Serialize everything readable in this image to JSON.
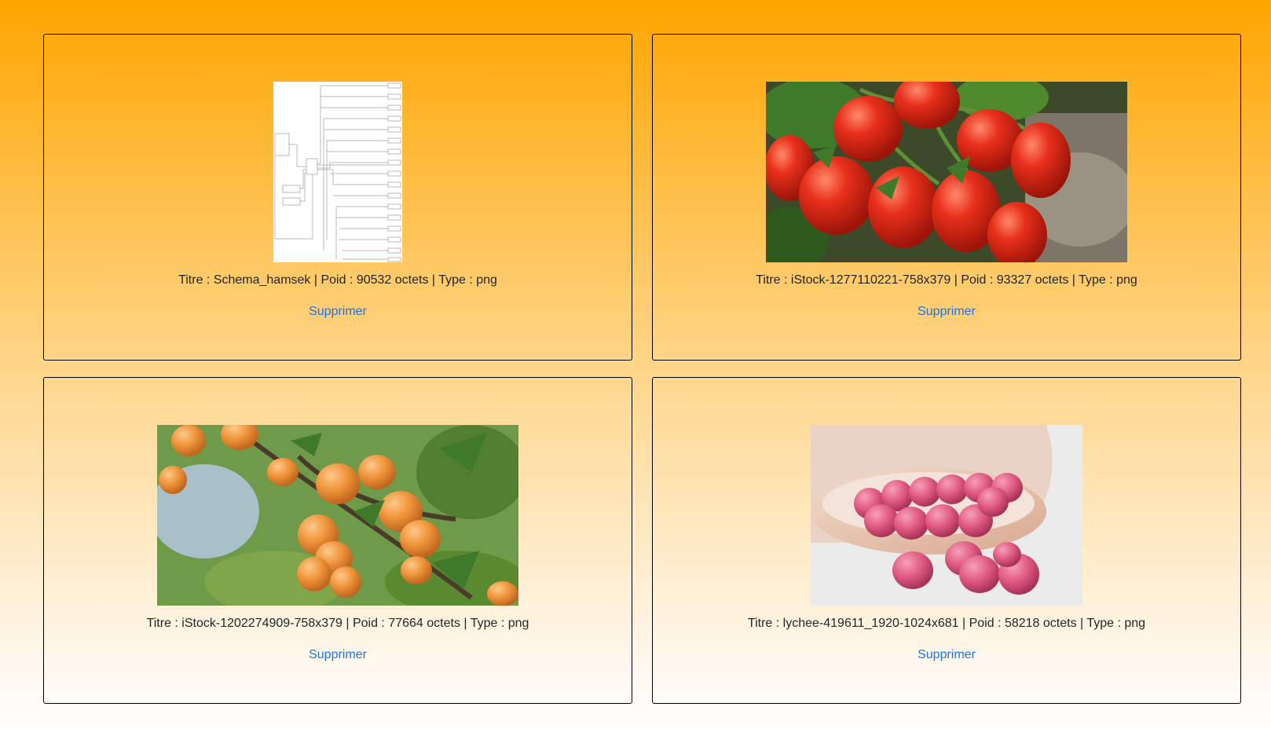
{
  "cards": [
    {
      "caption": "Titre : Schema_hamsek | Poid : 90532 octets | Type : png",
      "delete_label": "Supprimer",
      "image": "schema-diagram"
    },
    {
      "caption": "Titre : iStock-1277110221-758x379 | Poid : 93327 octets | Type : png",
      "delete_label": "Supprimer",
      "image": "tomatoes-photo"
    },
    {
      "caption": "Titre : iStock-1202274909-758x379 | Poid : 77664 octets | Type : png",
      "delete_label": "Supprimer",
      "image": "apricots-photo"
    },
    {
      "caption": "Titre : lychee-419611_1920-1024x681 | Poid : 58218 octets | Type : png",
      "delete_label": "Supprimer",
      "image": "lychees-photo"
    }
  ]
}
